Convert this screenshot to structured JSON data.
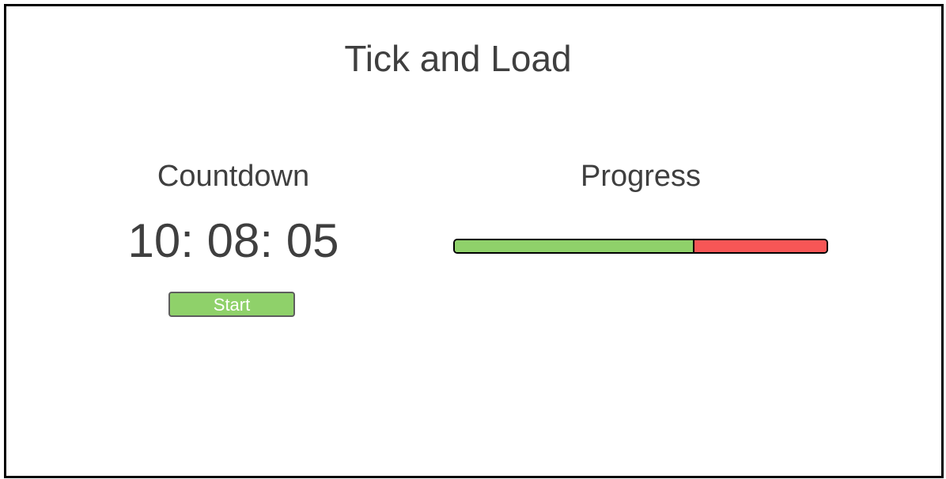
{
  "app": {
    "title": "Tick and Load"
  },
  "countdown": {
    "heading": "Countdown",
    "time": "10: 08: 05",
    "start_label": "Start"
  },
  "progress": {
    "heading": "Progress",
    "fraction": 0.645
  },
  "colors": {
    "text": "#3f3f3f",
    "start_button": "#8fd16a",
    "progress_fill": "#8fd16a",
    "progress_remaining": "#f75656",
    "border": "#000000"
  }
}
